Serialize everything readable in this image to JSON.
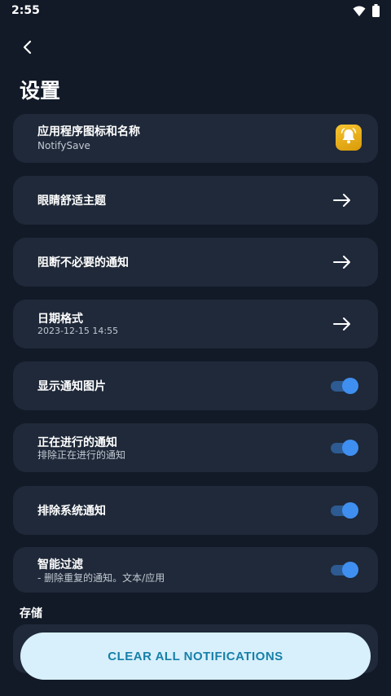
{
  "status_bar": {
    "time": "2:55",
    "icons": [
      "wifi-icon",
      "battery-icon"
    ]
  },
  "header": {
    "back_icon": "back-arrow-icon",
    "title": "设置"
  },
  "settings": [
    {
      "title": "应用程序图标和名称",
      "subtitle": "NotifySave",
      "control": "app-icon",
      "icon": "bell-icon"
    },
    {
      "title": "眼睛舒适主题",
      "control": "arrow"
    },
    {
      "title": "阻断不必要的通知",
      "control": "arrow"
    },
    {
      "title": "日期格式",
      "subtitle": "2023-12-15 14:55",
      "control": "arrow"
    },
    {
      "title": "显示通知图片",
      "control": "toggle",
      "on": true
    },
    {
      "title": "正在进行的通知",
      "subtitle": "排除正在进行的通知",
      "control": "toggle",
      "on": true
    },
    {
      "title": "排除系统通知",
      "control": "toggle",
      "on": true
    },
    {
      "title": "智能过滤",
      "subtitle": "- 删除重复的通知。文本/应用",
      "control": "toggle",
      "on": true
    }
  ],
  "storage_section": {
    "label": "存储"
  },
  "clear_button": {
    "label": "CLEAR ALL NOTIFICATIONS"
  },
  "colors": {
    "background": "#121a28",
    "card": "#1f2939",
    "toggle_on": "#3f8ff0",
    "button_bg": "#d8f0fc",
    "button_text": "#1680a8",
    "app_icon": "#f2b51e"
  }
}
